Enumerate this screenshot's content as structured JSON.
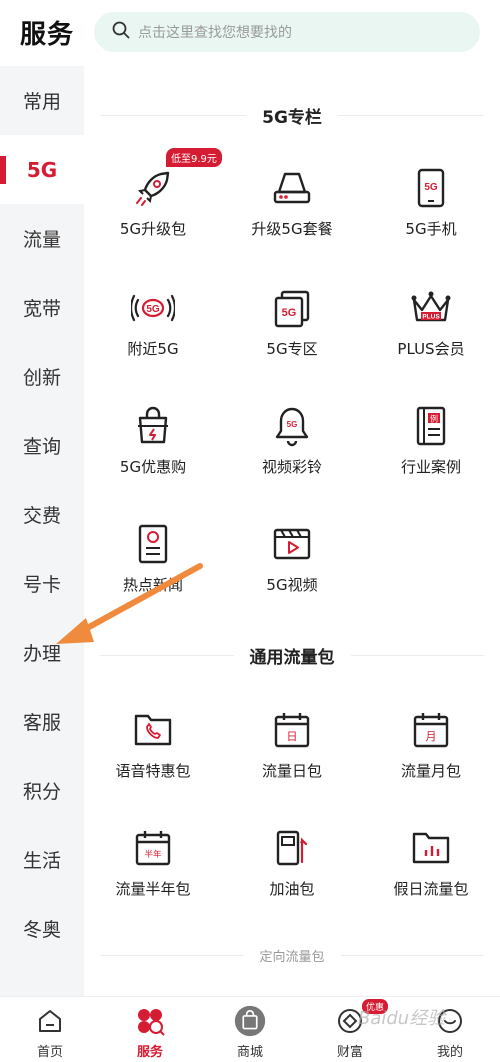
{
  "header": {
    "title": "服务",
    "search_placeholder": "点击这里查找您想要找的"
  },
  "sidebar": {
    "items": [
      {
        "label": "常用"
      },
      {
        "label": "5G"
      },
      {
        "label": "流量"
      },
      {
        "label": "宽带"
      },
      {
        "label": "创新"
      },
      {
        "label": "查询"
      },
      {
        "label": "交费"
      },
      {
        "label": "号卡"
      },
      {
        "label": "办理"
      },
      {
        "label": "客服"
      },
      {
        "label": "积分"
      },
      {
        "label": "生活"
      },
      {
        "label": "冬奥"
      }
    ],
    "active_label": "5G"
  },
  "main": {
    "section_5g": {
      "title": "5G专栏",
      "items": [
        {
          "label": "5G升级包",
          "icon": "rocket-icon",
          "badge": "低至9.9元"
        },
        {
          "label": "升级5G套餐",
          "icon": "router-icon"
        },
        {
          "label": "5G手机",
          "icon": "phone-5g-icon",
          "icon_text": "5G"
        },
        {
          "label": "附近5G",
          "icon": "signal-5g-icon",
          "icon_text": "5G"
        },
        {
          "label": "5G专区",
          "icon": "zone-5g-icon",
          "icon_text": "5G"
        },
        {
          "label": "PLUS会员",
          "icon": "crown-icon",
          "icon_text": "PLUS"
        },
        {
          "label": "5G优惠购",
          "icon": "shopping-bag-icon"
        },
        {
          "label": "视频彩铃",
          "icon": "bell-icon",
          "icon_text": "5G"
        },
        {
          "label": "行业案例",
          "icon": "book-icon",
          "icon_text": "例"
        },
        {
          "label": "热点新闻",
          "icon": "news-icon"
        },
        {
          "label": "5G视频",
          "icon": "video-icon"
        }
      ]
    },
    "section_data": {
      "title": "通用流量包",
      "items": [
        {
          "label": "语音特惠包",
          "icon": "phone-folder-icon"
        },
        {
          "label": "流量日包",
          "icon": "calendar-day-icon",
          "icon_text": "日"
        },
        {
          "label": "流量月包",
          "icon": "calendar-month-icon",
          "icon_text": "月"
        },
        {
          "label": "流量半年包",
          "icon": "calendar-halfyear-icon",
          "icon_text": "半年"
        },
        {
          "label": "加油包",
          "icon": "fuel-icon"
        },
        {
          "label": "假日流量包",
          "icon": "chart-folder-icon"
        }
      ]
    },
    "section_directed": {
      "title": "定向流量包"
    }
  },
  "tabbar": {
    "items": [
      {
        "label": "首页",
        "icon": "home-icon"
      },
      {
        "label": "服务",
        "icon": "service-icon"
      },
      {
        "label": "商城",
        "icon": "shop-bag-icon"
      },
      {
        "label": "财富",
        "icon": "wealth-icon",
        "badge": "优惠"
      },
      {
        "label": "我的",
        "icon": "user-icon"
      }
    ],
    "active_label": "服务"
  },
  "watermark": "Baidu经验",
  "colors": {
    "accent": "#d61c32",
    "search_bg": "#e9f6f1",
    "sidebar_bg": "#f4f5f7",
    "annotation_arrow": "#f08a3c"
  }
}
